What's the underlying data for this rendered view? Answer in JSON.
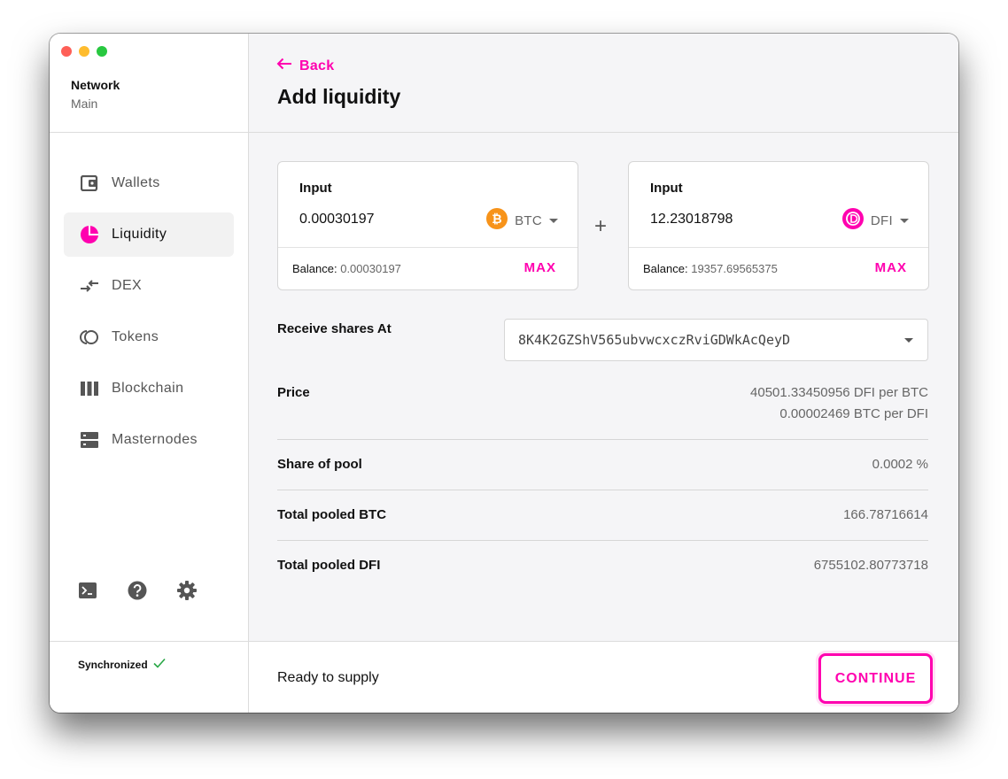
{
  "sidebar": {
    "network_title": "Network",
    "network_value": "Main",
    "items": [
      {
        "label": "Wallets",
        "icon": "wallet-icon"
      },
      {
        "label": "Liquidity",
        "icon": "pie-chart-icon",
        "active": true
      },
      {
        "label": "DEX",
        "icon": "swap-arrows-icon"
      },
      {
        "label": "Tokens",
        "icon": "tokens-icon"
      },
      {
        "label": "Blockchain",
        "icon": "blockchain-icon"
      },
      {
        "label": "Masternodes",
        "icon": "server-icon"
      }
    ],
    "tools": [
      "terminal-icon",
      "help-icon",
      "gear-icon"
    ],
    "sync_label": "Synchronized"
  },
  "header": {
    "back_label": "Back",
    "title": "Add liquidity"
  },
  "inputs": [
    {
      "label": "Input",
      "value": "0.00030197",
      "token": "BTC",
      "balance_label": "Balance:",
      "balance_value": "0.00030197",
      "max_label": "MAX"
    },
    {
      "label": "Input",
      "value": "12.23018798",
      "token": "DFI",
      "balance_label": "Balance:",
      "balance_value": "19357.69565375",
      "max_label": "MAX"
    }
  ],
  "plus": "+",
  "receive": {
    "label": "Receive shares At",
    "address": "8K4K2GZShV565ubvwcxczRviGDWkAcQeyD"
  },
  "details": {
    "price_label": "Price",
    "price_line1": "40501.33450956 DFI per BTC",
    "price_line2": "0.00002469 BTC per DFI",
    "share_label": "Share of pool",
    "share_value": "0.0002 %",
    "pooled_btc_label": "Total pooled BTC",
    "pooled_btc_value": "166.78716614",
    "pooled_dfi_label": "Total pooled DFI",
    "pooled_dfi_value": "6755102.80773718"
  },
  "footer": {
    "status": "Ready to supply",
    "continue_label": "CONTINUE"
  },
  "colors": {
    "accent": "#ff00af",
    "btc": "#f7931a",
    "dfi": "#ff00af",
    "sync_check": "#28a745"
  }
}
